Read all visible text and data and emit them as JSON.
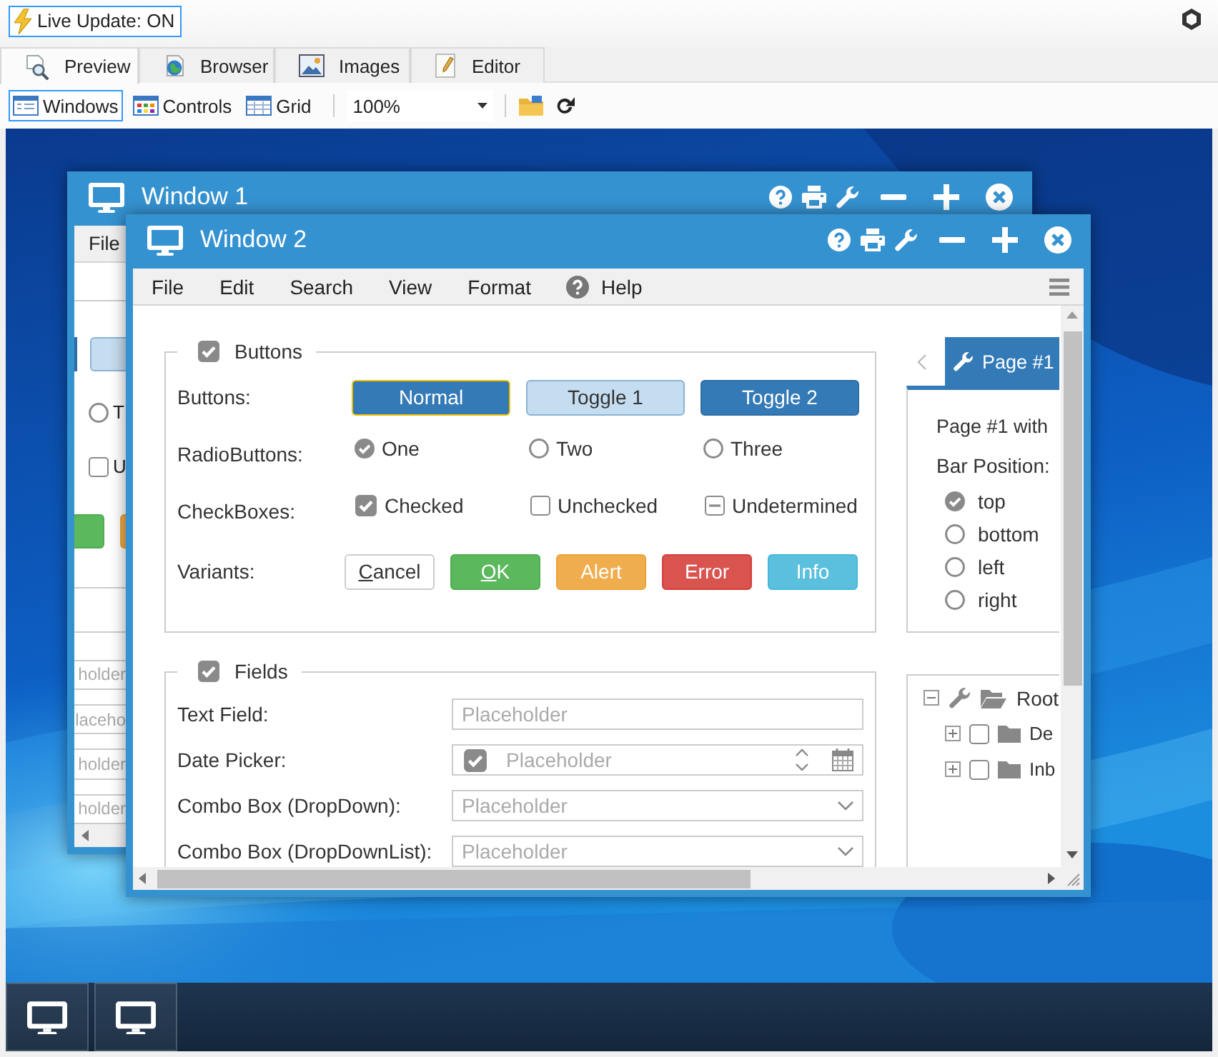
{
  "live_update": {
    "label": "Live Update: ON"
  },
  "tabs": [
    {
      "label": "Preview",
      "kind": "preview",
      "selected": true
    },
    {
      "label": "Browser",
      "kind": "browser",
      "selected": false
    },
    {
      "label": "Images",
      "kind": "images",
      "selected": false
    },
    {
      "label": "Editor",
      "kind": "editor",
      "selected": false
    }
  ],
  "toolbar": {
    "views": [
      {
        "label": "Windows",
        "kind": "windows",
        "selected": true
      },
      {
        "label": "Controls",
        "kind": "controls",
        "selected": false
      },
      {
        "label": "Grid",
        "kind": "grid",
        "selected": false
      }
    ],
    "zoom": {
      "value": "100%"
    }
  },
  "window_1": {
    "title": "Window 1",
    "menu": [
      {
        "label": "File",
        "icon": false
      }
    ],
    "radio": {
      "label": "T",
      "selected": false
    },
    "checkbox": {
      "label": "U",
      "checked": false
    },
    "field_texts": [
      "holder",
      "laceho",
      "holder",
      "holder"
    ]
  },
  "window_2": {
    "title": "Window 2",
    "menu": [
      {
        "label": "File",
        "icon": false
      },
      {
        "label": "Edit",
        "icon": false
      },
      {
        "label": "Search",
        "icon": false
      },
      {
        "label": "View",
        "icon": false
      },
      {
        "label": "Format",
        "icon": false
      },
      {
        "label": "Help",
        "icon": true
      }
    ],
    "buttons_group": {
      "title": "Buttons",
      "checked": true,
      "buttons": {
        "label": "Buttons:",
        "items": [
          {
            "label": "Normal",
            "kind": "push",
            "focused": true
          },
          {
            "label": "Toggle 1",
            "kind": "toggle",
            "focused": false,
            "pressed": false
          },
          {
            "label": "Toggle 2",
            "kind": "toggle",
            "focused": false,
            "pressed": true
          }
        ]
      },
      "radio_buttons": {
        "label": "RadioButtons:",
        "items": [
          {
            "label": "One",
            "selected": true
          },
          {
            "label": "Two",
            "selected": false
          },
          {
            "label": "Three",
            "selected": false
          }
        ]
      },
      "check_boxes": {
        "label": "CheckBoxes:",
        "items": [
          {
            "label": "Checked",
            "checked": true,
            "indeterminate": false
          },
          {
            "label": "Unchecked",
            "checked": false,
            "indeterminate": false
          },
          {
            "label": "Undetermined",
            "checked": false,
            "indeterminate": true
          }
        ]
      },
      "variants": {
        "label": "Variants:",
        "items": [
          {
            "label": "Cancel",
            "kind": "default",
            "underline_first": true
          },
          {
            "label": "OK",
            "kind": "success",
            "underline_first": true
          },
          {
            "label": "Alert",
            "kind": "warning",
            "underline_first": false
          },
          {
            "label": "Error",
            "kind": "danger",
            "underline_first": false
          },
          {
            "label": "Info",
            "kind": "info",
            "underline_first": false
          }
        ]
      }
    },
    "fields_group": {
      "title": "Fields",
      "checked": true,
      "fields": [
        {
          "label": "Text Field:",
          "kind": "text",
          "placeholder": "Placeholder"
        },
        {
          "label": "Date Picker:",
          "kind": "date",
          "placeholder": "Placeholder",
          "checked": true
        },
        {
          "label": "Combo Box (DropDown):",
          "kind": "combo",
          "placeholder": "Placeholder"
        },
        {
          "label": "Combo Box (DropDownList):",
          "kind": "combo",
          "placeholder": "Placeholder"
        }
      ]
    },
    "tab_panel": {
      "tabs": [
        {
          "label": "Page #1",
          "selected": true
        }
      ],
      "text": "Page #1 with",
      "bar_position": {
        "label": "Bar Position:",
        "options": [
          {
            "label": "top",
            "selected": true
          },
          {
            "label": "bottom",
            "selected": false
          },
          {
            "label": "left",
            "selected": false
          },
          {
            "label": "right",
            "selected": false
          }
        ]
      }
    },
    "tree": {
      "label": "Root",
      "expanded": true,
      "children": [
        {
          "label": "De",
          "expanded": false,
          "checked": false
        },
        {
          "label": "Inb",
          "expanded": false,
          "checked": false
        }
      ]
    }
  }
}
